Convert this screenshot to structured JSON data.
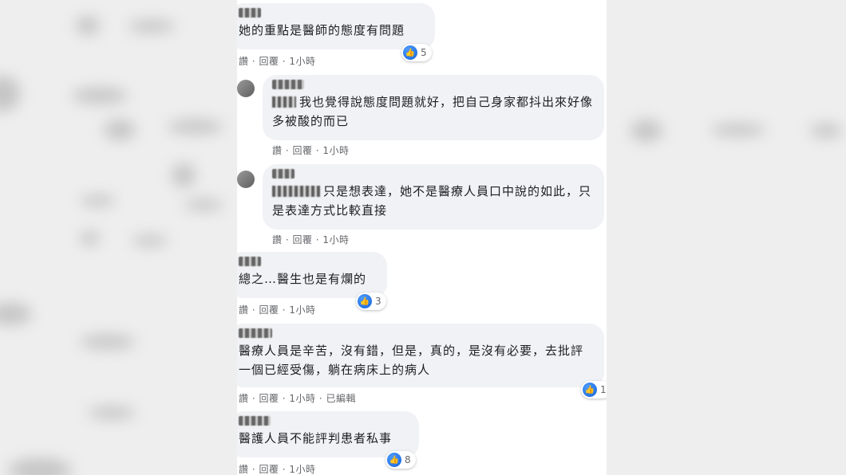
{
  "comments": [
    {
      "text": "她的重點是醫師的態度有問題",
      "actions": "讚 · 回覆 · 1小時",
      "reactions": "5"
    },
    {
      "text": "我也覺得說態度問題就好，把自己身家都抖出來好像多被酸的而已",
      "actions": "讚 · 回覆 · 1小時"
    },
    {
      "text": "只是想表達，她不是醫療人員口中說的如此，只是表達方式比較直接",
      "actions": "讚 · 回覆 · 1小時"
    },
    {
      "text": "總之…醫生也是有爛的",
      "actions": "讚 · 回覆 · 1小時",
      "reactions": "3"
    },
    {
      "text": "醫療人員是辛苦，沒有錯，但是，真的，是沒有必要，去批評一個已經受傷，躺在病床上的病人",
      "actions": "讚 · 回覆 · 1小時 · 已編輯",
      "reactions": "1"
    },
    {
      "text": "醫護人員不能評判患者私事",
      "actions": "讚 · 回覆 · 1小時",
      "reactions": "8"
    }
  ],
  "icons": {
    "like": "thumbs-up-icon"
  },
  "colors": {
    "like": "#1877f2",
    "bubble": "#f0f2f5",
    "meta": "#65676b"
  }
}
